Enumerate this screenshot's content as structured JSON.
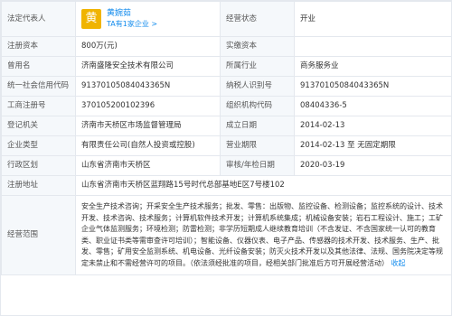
{
  "rows": {
    "legal_rep_label": "法定代表人",
    "legal_rep_avatar": "黄",
    "legal_rep_name": "黄婉茹",
    "legal_rep_sub": "TA有1家企业 >",
    "status_label": "经营状态",
    "status_value": "开业",
    "capital_label": "注册资本",
    "capital_value": "800万(元)",
    "paid_label": "实缴资本",
    "paid_value": "",
    "former_name_label": "曾用名",
    "former_name_value": "济南盛隆安全技术有限公司",
    "industry_label": "所属行业",
    "industry_value": "商务服务业",
    "credit_code_label": "统一社会信用代码",
    "credit_code_value": "91370105084043365N",
    "taxpayer_label": "纳税人识别号",
    "taxpayer_value": "91370105084043365N",
    "reg_no_label": "工商注册号",
    "reg_no_value": "370105200102396",
    "org_code_label": "组织机构代码",
    "org_code_value": "08404336-5",
    "authority_label": "登记机关",
    "authority_value": "济南市天桥区市场监督管理局",
    "founded_label": "成立日期",
    "founded_value": "2014-02-13",
    "type_label": "企业类型",
    "type_value": "有限责任公司(自然人投资或控股)",
    "term_label": "营业期限",
    "term_value": "2014-02-13 至 无固定期限",
    "district_label": "行政区划",
    "district_value": "山东省济南市天桥区",
    "approval_label": "审核/年检日期",
    "approval_value": "2020-03-19",
    "address_label": "注册地址",
    "address_value": "山东省济南市天桥区蓝翔路15号时代总部基地E区7号楼102",
    "scope_label": "经营范围",
    "scope_value": "安全生产技术咨询；开采安全生产技术服务；批发、零售：出版物、监控设备、检测设备；监控系统的设计、技术开发、技术咨询、技术服务；计算机软件技术开发；计算机系统集成；机械设备安装；岩石工程设计、施工；工矿企业气体监测服务；环境检测；防雷检测；非学历短期成人继续教育培训（不含发证、不含国家统一认可的教育类、职业证书类等需审查许可培训）；智能设备、仪器仪表、电子产品、传感器的技术开发、技术服务、生产、批发、零售；矿用安全监测系统、机电设备、光纤设备安装；防灭火技术开发以及其他法律、法规、国务院决定等规定未禁止和不需经营许可的项目。（依法须经批准的项目，经相关部门批准后方可开展经营活动）",
    "scope_more": "收起"
  }
}
